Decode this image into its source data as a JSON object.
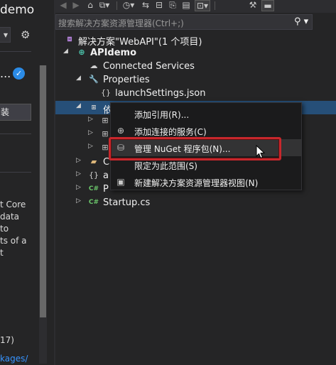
{
  "left_panel": {
    "title_fragment": "demo",
    "name_fragment": "...",
    "button_fragment": "装",
    "description_lines": [
      "t Core",
      "data",
      "to",
      "ts of a",
      "t"
    ],
    "count_fragment": "17)",
    "link_fragment": "kages/"
  },
  "toolbar": {
    "icons": [
      "back-icon",
      "forward-icon",
      "home-icon",
      "switch-views-icon",
      "history-icon",
      "sync-icon",
      "collapse-all-icon",
      "show-all-files-icon",
      "preview-icon",
      "properties-icon",
      "pin-icon"
    ]
  },
  "search": {
    "placeholder": "搜索解决方案资源管理器(Ctrl+;)",
    "button_glyph": "⚲ ▾"
  },
  "tree": {
    "solution": "解决方案\"WebAPI\"(1 个项目)",
    "project": "APIdemo",
    "connected_services": "Connected Services",
    "properties": "Properties",
    "launch_settings": "launchSettings.json",
    "dependencies": "依",
    "controllers_fragment": "C",
    "appsettings_fragment": "a",
    "program_fragment": "P",
    "startup": "Startup.cs",
    "cs_badge": "C#"
  },
  "context_menu": {
    "items": [
      {
        "label": "添加引用(R)...",
        "icon": ""
      },
      {
        "label": "添加连接的服务(C)",
        "icon": "connected-service-icon"
      },
      {
        "label": "管理 NuGet 程序包(N)...",
        "icon": "nuget-icon"
      },
      {
        "label": "限定为此范围(S)",
        "icon": ""
      },
      {
        "label": "新建解决方案资源管理器视图(N)",
        "icon": "new-view-icon"
      }
    ]
  },
  "colors": {
    "background": "#252526",
    "selection": "#264f78",
    "highlight_box": "#c8272c",
    "link": "#3794ff"
  }
}
